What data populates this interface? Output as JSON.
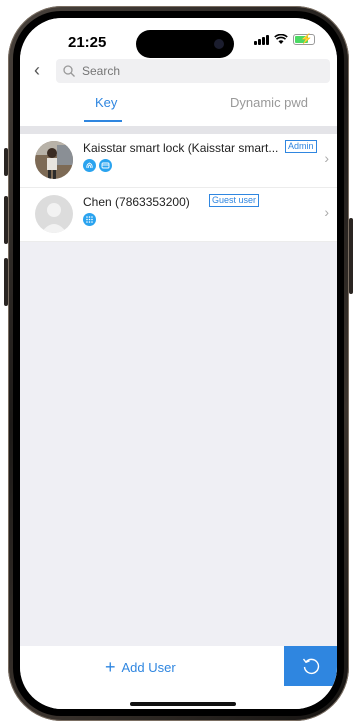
{
  "status_bar": {
    "time": "21:25"
  },
  "search": {
    "placeholder": "Search"
  },
  "tabs": [
    {
      "label": "Key",
      "active": true
    },
    {
      "label": "Dynamic pwd",
      "active": false
    }
  ],
  "users": [
    {
      "name": "Kaisstar smart lock (Kaisstar smart...",
      "badge": "Admin",
      "permission_icons": [
        "fingerprint-icon",
        "card-icon"
      ]
    },
    {
      "name": "Chen (7863353200)",
      "badge": "Guest user",
      "permission_icons": [
        "keypad-icon"
      ]
    }
  ],
  "footer": {
    "add_user_label": "Add User"
  },
  "colors": {
    "accent": "#2f86e0",
    "permission_icon": "#2aa3ef",
    "background": "#efeff4"
  }
}
